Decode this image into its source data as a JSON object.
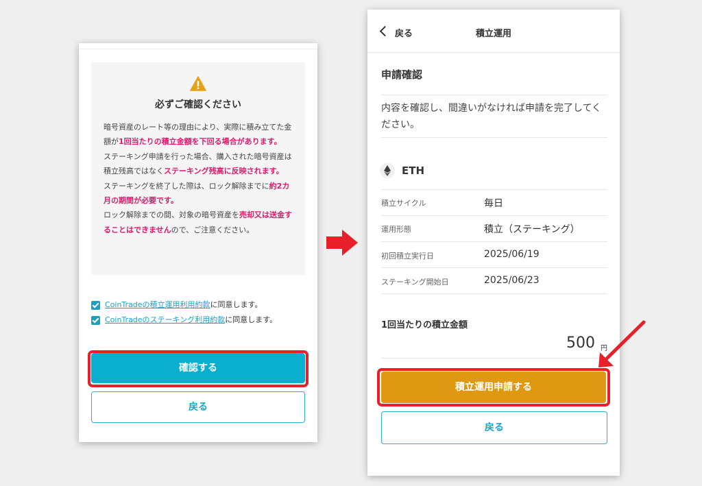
{
  "left_screen": {
    "notice_title": "必ずご確認ください",
    "notice": {
      "p1_a": "暗号資産のレート等の理由により、実際に積み立てた金額が",
      "p1_b": "1回当たりの積立金額を下回る場合があります",
      "p1_c": "。",
      "p2_a": "ステーキング申請を行った場合、購入された暗号資産は積立残高ではなく",
      "p2_b": "ステーキング残高に反映されます",
      "p2_c": "。",
      "p3_a": "ステーキングを終了した際は、ロック解除までに",
      "p3_b": "約2カ月の期間が必要です",
      "p3_c": "。",
      "p4_a": "ロック解除までの間、対象の暗号資産を",
      "p4_b": "売却又は送金することはできません",
      "p4_c": "ので、ご注意ください。"
    },
    "checkboxes": [
      {
        "link": "CoinTradeの積立運用利用約款",
        "suffix": "に同意します。"
      },
      {
        "link": "CoinTradeのステーキング利用約款",
        "suffix": "に同意します。"
      }
    ],
    "confirm_label": "確認する",
    "back_label": "戻る"
  },
  "right_screen": {
    "header": {
      "back_label": "戻る",
      "title": "積立運用"
    },
    "section_title": "申請確認",
    "description": "内容を確認し、間違いがなければ申請を完了してください。",
    "coin": "ETH",
    "details": [
      {
        "label": "積立サイクル",
        "value": "毎日"
      },
      {
        "label": "運用形態",
        "value": "積立（ステーキング）"
      },
      {
        "label": "初回積立実行日",
        "value": "2025/06/19"
      },
      {
        "label": "ステーキング開始日",
        "value": "2025/06/23"
      }
    ],
    "amount_label": "1回当たりの積立金額",
    "amount_value": "500",
    "amount_unit": "円",
    "submit_label": "積立運用申請する",
    "back_label": "戻る"
  },
  "colors": {
    "primary": "#0aaecf",
    "orange": "#df9811",
    "highlight": "#e0186c",
    "annotation_red": "#e8202a"
  }
}
